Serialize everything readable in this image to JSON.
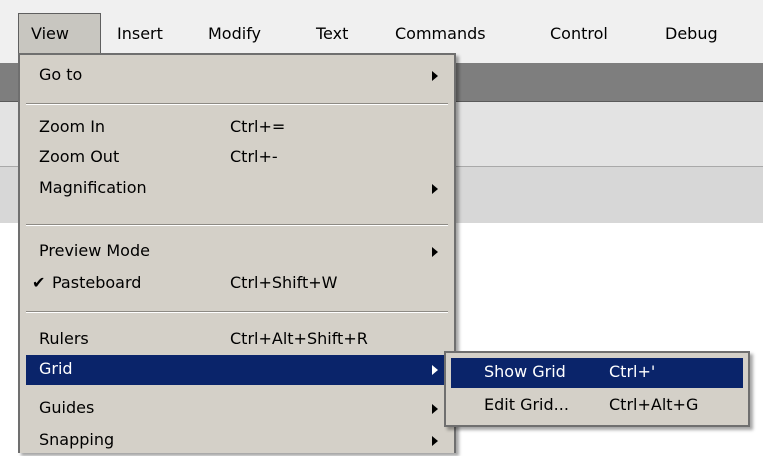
{
  "menubar": {
    "items": [
      {
        "label": "View"
      },
      {
        "label": "Insert"
      },
      {
        "label": "Modify"
      },
      {
        "label": "Text"
      },
      {
        "label": "Commands"
      },
      {
        "label": "Control"
      },
      {
        "label": "Debug"
      }
    ],
    "active": "View"
  },
  "view_menu": {
    "items": [
      {
        "label": "Go to",
        "shortcut": "",
        "submenu": true
      },
      {
        "label": "Zoom In",
        "shortcut": "Ctrl+="
      },
      {
        "label": "Zoom Out",
        "shortcut": "Ctrl+-"
      },
      {
        "label": "Magnification",
        "shortcut": "",
        "submenu": true
      },
      {
        "label": "Preview Mode",
        "shortcut": "",
        "submenu": true
      },
      {
        "label": "Pasteboard",
        "shortcut": "Ctrl+Shift+W",
        "checked": true,
        "check_glyph": "✔"
      },
      {
        "label": "Rulers",
        "shortcut": "Ctrl+Alt+Shift+R"
      },
      {
        "label": "Grid",
        "shortcut": "",
        "submenu": true,
        "highlighted": true
      },
      {
        "label": "Guides",
        "shortcut": "",
        "submenu": true
      },
      {
        "label": "Snapping",
        "shortcut": "",
        "submenu": true
      }
    ]
  },
  "grid_submenu": {
    "items": [
      {
        "label": "Show Grid",
        "shortcut": "Ctrl+'",
        "highlighted": true
      },
      {
        "label": "Edit Grid...",
        "shortcut": "Ctrl+Alt+G"
      }
    ]
  },
  "colors": {
    "highlight": "#0a246a",
    "menu_bg": "#d4d0c8",
    "menubar_bg": "#f0f0f0"
  }
}
